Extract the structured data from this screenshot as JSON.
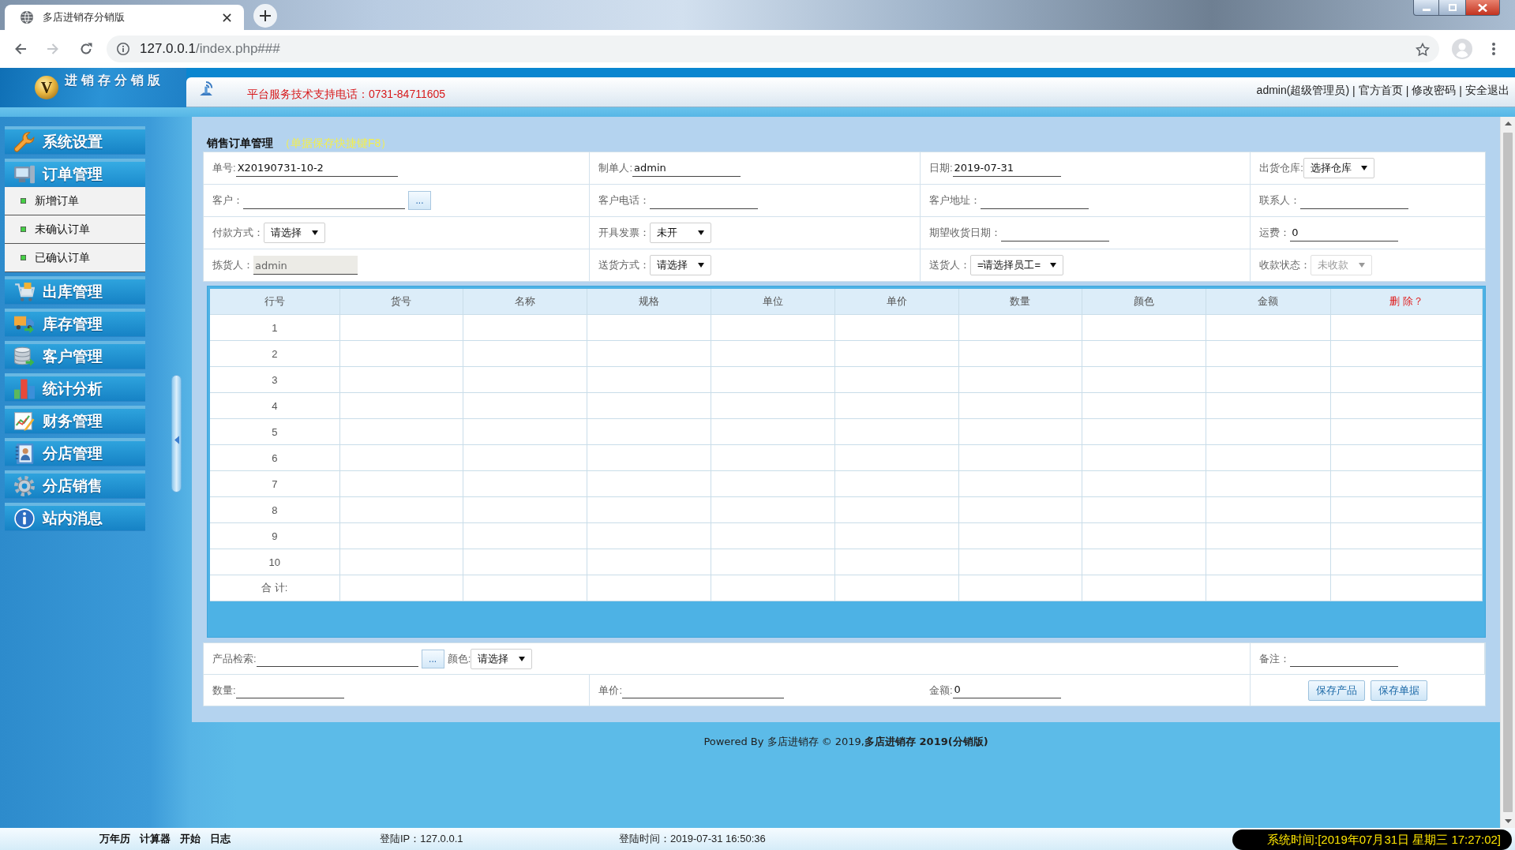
{
  "browser": {
    "tab_title": "多店进销存分销版",
    "url_host": "127.0.0.1",
    "url_path": "/index.php###"
  },
  "header": {
    "logo_letter": "V",
    "logo_title": "进销存分销版",
    "support_phone": "平台服务技术支持电话：0731-84711605",
    "user": "admin(超级管理员)",
    "links": [
      "官方首页",
      "修改密码",
      "安全退出"
    ],
    "separator": "|"
  },
  "sidebar": {
    "items": [
      {
        "label": "系统设置",
        "expanded": false
      },
      {
        "label": "订单管理",
        "expanded": true,
        "children": [
          {
            "label": "新增订单"
          },
          {
            "label": "未确认订单"
          },
          {
            "label": "已确认订单"
          }
        ]
      },
      {
        "label": "出库管理",
        "expanded": false
      },
      {
        "label": "库存管理",
        "expanded": false
      },
      {
        "label": "客户管理",
        "expanded": false
      },
      {
        "label": "统计分析",
        "expanded": false
      },
      {
        "label": "财务管理",
        "expanded": false
      },
      {
        "label": "分店管理",
        "expanded": false
      },
      {
        "label": "分店销售",
        "expanded": false
      },
      {
        "label": "站内消息",
        "expanded": false
      }
    ]
  },
  "panel": {
    "title": "销售订单管理",
    "hint": "（单据保存快捷键F8）"
  },
  "order_form": {
    "rows": [
      {
        "cells": [
          {
            "fields": [
              {
                "kind": "text",
                "label": "单号:",
                "value": "X20190731-10-2"
              }
            ]
          },
          {
            "fields": [
              {
                "kind": "text",
                "label": "制单人:",
                "value": "admin"
              }
            ]
          },
          {
            "fields": [
              {
                "kind": "text",
                "label": "日期:",
                "value": "2019-07-31"
              }
            ]
          },
          {
            "fields": [
              {
                "kind": "select",
                "label": "出货仓库:",
                "value": "选择仓库",
                "disabled": false
              }
            ]
          }
        ]
      },
      {
        "cells": [
          {
            "fields": [
              {
                "kind": "lookup",
                "label": "客户：",
                "button": "..."
              }
            ]
          },
          {
            "fields": [
              {
                "kind": "text",
                "label": "客户电话："
              }
            ]
          },
          {
            "fields": [
              {
                "kind": "text",
                "label": "客户地址："
              }
            ]
          },
          {
            "fields": [
              {
                "kind": "text",
                "label": "联系人："
              }
            ]
          }
        ]
      },
      {
        "cells": [
          {
            "fields": [
              {
                "kind": "select",
                "label": "付款方式：",
                "value": "请选择",
                "disabled": false
              }
            ]
          },
          {
            "fields": [
              {
                "kind": "select",
                "label": "开具发票：",
                "value": "未开",
                "disabled": false
              }
            ]
          },
          {
            "fields": [
              {
                "kind": "text",
                "label": "期望收货日期："
              }
            ]
          },
          {
            "fields": [
              {
                "kind": "text",
                "label": "运费：",
                "value": "0"
              }
            ]
          }
        ]
      },
      {
        "cells": [
          {
            "fields": [
              {
                "kind": "readonly",
                "label": "拣货人：",
                "value": "admin"
              }
            ]
          },
          {
            "fields": [
              {
                "kind": "select",
                "label": "送货方式：",
                "value": "请选择",
                "disabled": false
              }
            ]
          },
          {
            "fields": [
              {
                "kind": "select",
                "label": "送货人：",
                "value": "=请选择员工=",
                "disabled": false
              }
            ]
          },
          {
            "fields": [
              {
                "kind": "select",
                "label": "收款状态：",
                "value": "未收款",
                "disabled": true
              }
            ]
          }
        ]
      }
    ]
  },
  "items_table": {
    "columns": [
      {
        "label": "行号",
        "kind": "data"
      },
      {
        "label": "货号",
        "kind": "data"
      },
      {
        "label": "名称",
        "kind": "data"
      },
      {
        "label": "规格",
        "kind": "data"
      },
      {
        "label": "单位",
        "kind": "data"
      },
      {
        "label": "单价",
        "kind": "data"
      },
      {
        "label": "数量",
        "kind": "data"
      },
      {
        "label": "颜色",
        "kind": "data"
      },
      {
        "label": "金额",
        "kind": "data"
      },
      {
        "label": "删 除？",
        "kind": "action"
      }
    ],
    "rows": [
      "1",
      "2",
      "3",
      "4",
      "5",
      "6",
      "7",
      "8",
      "9",
      "10"
    ],
    "total_label": "合 计:"
  },
  "entry_form": {
    "rows": [
      {
        "cells": [
          {
            "fields": [
              {
                "kind": "lookup",
                "label": "产品检索:",
                "button": "..."
              },
              {
                "kind": "select",
                "label": "颜色:",
                "value": "请选择",
                "disabled": false
              }
            ]
          },
          {
            "fields": [
              {
                "kind": "text",
                "label": "备注："
              }
            ]
          }
        ]
      },
      {
        "cells": [
          {
            "fields": [
              {
                "kind": "text",
                "label": "数量:"
              }
            ]
          },
          {
            "fields": [
              {
                "kind": "text",
                "label": "单价:"
              }
            ]
          },
          {
            "fields": [
              {
                "kind": "text",
                "label": "金额:",
                "value": "0"
              }
            ]
          },
          {
            "fields": [
              {
                "kind": "button",
                "label": "保存产品"
              },
              {
                "kind": "button",
                "label": "保存单据"
              }
            ]
          }
        ]
      }
    ]
  },
  "footer": {
    "powered_by": "Powered By 多店进销存 © 2019,**多店进销存 2019(分销版)**"
  },
  "status_bar": {
    "tools": [
      "万年历",
      "计算器",
      "开始",
      "日志"
    ],
    "login_ip": "登陆IP：127.0.0.1",
    "login_time": "登陆时间：2019-07-31 16:50:36",
    "system_time": "系统时间:[2019年07月31日 星期三 17:27:02]"
  }
}
